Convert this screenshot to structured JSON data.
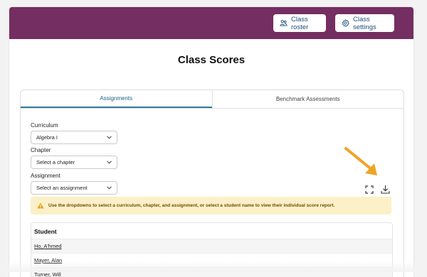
{
  "header": {
    "roster_label": "Class roster",
    "settings_label": "Class settings",
    "accent_color": "#742e62"
  },
  "page": {
    "title": "Class Scores"
  },
  "tabs": [
    {
      "label": "Assignments",
      "active": true
    },
    {
      "label": "Benchmark Assessments",
      "active": false
    }
  ],
  "filters": {
    "curriculum": {
      "label": "Curriculum",
      "value": "Algebra I"
    },
    "chapter": {
      "label": "Chapter",
      "value": "Select a chapter"
    },
    "assignment": {
      "label": "Assignment",
      "value": "Select an assignment"
    }
  },
  "toolbar": {
    "icons": [
      "fullscreen-icon",
      "download-icon"
    ]
  },
  "alert": {
    "text": "Use the dropdowns to select a curriculum, chapter, and assignment, or select a student name to view their individual score report.",
    "color": "#fbf0c7"
  },
  "students": {
    "header": "Student",
    "rows": [
      "Ho, A'hmed",
      "Mayer, Alan",
      "Turner, Will"
    ]
  },
  "annotation": {
    "arrow_color": "#f0a326"
  }
}
